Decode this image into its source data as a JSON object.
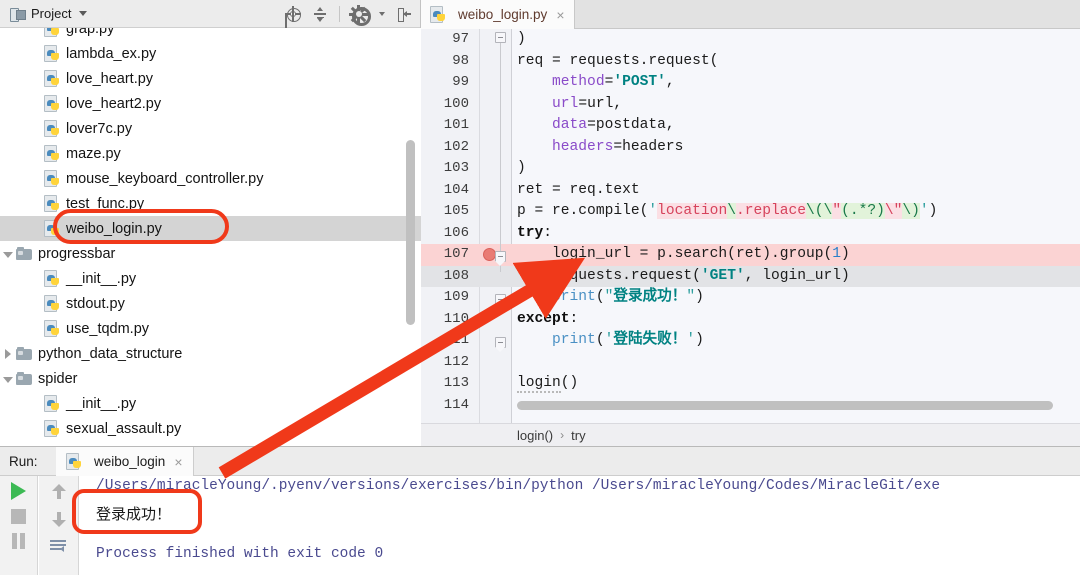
{
  "project_panel": {
    "title": "Project",
    "icons": [
      {
        "name": "locate-target-icon"
      },
      {
        "name": "collapse-all-icon"
      },
      {
        "name": "settings-gear-icon"
      },
      {
        "name": "hide-panel-icon"
      }
    ],
    "tree": [
      {
        "label": "grap.py",
        "type": "py",
        "indent": 2,
        "selected": false,
        "twisty": "none",
        "clipped": true
      },
      {
        "label": "lambda_ex.py",
        "type": "py",
        "indent": 2,
        "selected": false,
        "twisty": "none"
      },
      {
        "label": "love_heart.py",
        "type": "py",
        "indent": 2,
        "selected": false,
        "twisty": "none"
      },
      {
        "label": "love_heart2.py",
        "type": "py",
        "indent": 2,
        "selected": false,
        "twisty": "none"
      },
      {
        "label": "lover7c.py",
        "type": "py",
        "indent": 2,
        "selected": false,
        "twisty": "none"
      },
      {
        "label": "maze.py",
        "type": "py",
        "indent": 2,
        "selected": false,
        "twisty": "none"
      },
      {
        "label": "mouse_keyboard_controller.py",
        "type": "py",
        "indent": 2,
        "selected": false,
        "twisty": "none"
      },
      {
        "label": "test_func.py",
        "type": "py",
        "indent": 2,
        "selected": false,
        "twisty": "none"
      },
      {
        "label": "weibo_login.py",
        "type": "py",
        "indent": 2,
        "selected": true,
        "twisty": "none"
      },
      {
        "label": "progressbar",
        "type": "folder",
        "indent": 1,
        "selected": false,
        "twisty": "open"
      },
      {
        "label": "__init__.py",
        "type": "py",
        "indent": 2,
        "selected": false,
        "twisty": "none"
      },
      {
        "label": "stdout.py",
        "type": "py",
        "indent": 2,
        "selected": false,
        "twisty": "none"
      },
      {
        "label": "use_tqdm.py",
        "type": "py",
        "indent": 2,
        "selected": false,
        "twisty": "none"
      },
      {
        "label": "python_data_structure",
        "type": "folder",
        "indent": 1,
        "selected": false,
        "twisty": "closed"
      },
      {
        "label": "spider",
        "type": "folder",
        "indent": 1,
        "selected": false,
        "twisty": "open"
      },
      {
        "label": "__init__.py",
        "type": "py",
        "indent": 2,
        "selected": false,
        "twisty": "none"
      },
      {
        "label": "sexual_assault.py",
        "type": "py",
        "indent": 2,
        "selected": false,
        "twisty": "none"
      }
    ]
  },
  "editor": {
    "tab": {
      "label": "weibo_login.py",
      "close": "×",
      "icon": "python-file-icon"
    },
    "first_line": 97,
    "lines": [
      {
        "no": 97,
        "text": ")",
        "highlight": "none"
      },
      {
        "no": 98,
        "text": "req = requests.request(",
        "highlight": "none"
      },
      {
        "no": 99,
        "text": "    method='POST',",
        "highlight": "none"
      },
      {
        "no": 100,
        "text": "    url=url,",
        "highlight": "none"
      },
      {
        "no": 101,
        "text": "    data=postdata,",
        "highlight": "none"
      },
      {
        "no": 102,
        "text": "    headers=headers",
        "highlight": "none"
      },
      {
        "no": 103,
        "text": ")",
        "highlight": "none"
      },
      {
        "no": 104,
        "text": "ret = req.text",
        "highlight": "none"
      },
      {
        "no": 105,
        "text": "p = re.compile('location\\.replace\\(\\\"(.*?)\\\"\\)')",
        "highlight": "none"
      },
      {
        "no": 106,
        "text": "try:",
        "highlight": "none"
      },
      {
        "no": 107,
        "text": "    login_url = p.search(ret).group(1)",
        "highlight": "red",
        "breakpoint": true
      },
      {
        "no": 108,
        "text": "    requests.request('GET', login_url)",
        "highlight": "gray",
        "bulb": true
      },
      {
        "no": 109,
        "text": "    print(\"登录成功！\")",
        "highlight": "none"
      },
      {
        "no": 110,
        "text": "except:",
        "highlight": "none"
      },
      {
        "no": 111,
        "text": "    print('登陆失败！')",
        "highlight": "none"
      },
      {
        "no": 112,
        "text": "",
        "highlight": "none"
      },
      {
        "no": 113,
        "text": "login()",
        "highlight": "none"
      },
      {
        "no": 114,
        "text": "",
        "highlight": "none"
      }
    ],
    "breadcrumb": [
      {
        "label": "login()"
      },
      {
        "label": "›",
        "separator": true
      },
      {
        "label": "try"
      }
    ]
  },
  "run_panel": {
    "label": "Run:",
    "tab": {
      "label": "weibo_login",
      "close": "×",
      "icon": "python-file-icon"
    },
    "controls": [
      {
        "name": "rerun-button",
        "icon": "play-icon"
      },
      {
        "name": "stop-button",
        "icon": "stop-icon"
      },
      {
        "name": "pause-button",
        "icon": "pause-icon"
      },
      {
        "name": "scroll-up-button",
        "icon": "arrow-up-icon"
      },
      {
        "name": "scroll-down-button",
        "icon": "arrow-down-icon"
      },
      {
        "name": "soft-wrap-button",
        "icon": "soft-wrap-icon"
      }
    ],
    "output": [
      {
        "text": "/Users/miracleYoung/.pyenv/versions/exercises/bin/python /Users/miracleYoung/Codes/MiracleGit/exe",
        "kind": "path"
      },
      {
        "text": "登录成功！",
        "kind": "cjk"
      },
      {
        "text": "Process finished with exit code 0",
        "kind": "path"
      }
    ]
  },
  "annotations": {
    "color": "#f0391a",
    "boxes": [
      {
        "name": "highlight-box-weibo-login-file"
      },
      {
        "name": "highlight-box-console-success"
      }
    ],
    "arrow": {
      "name": "pointer-arrow"
    }
  }
}
